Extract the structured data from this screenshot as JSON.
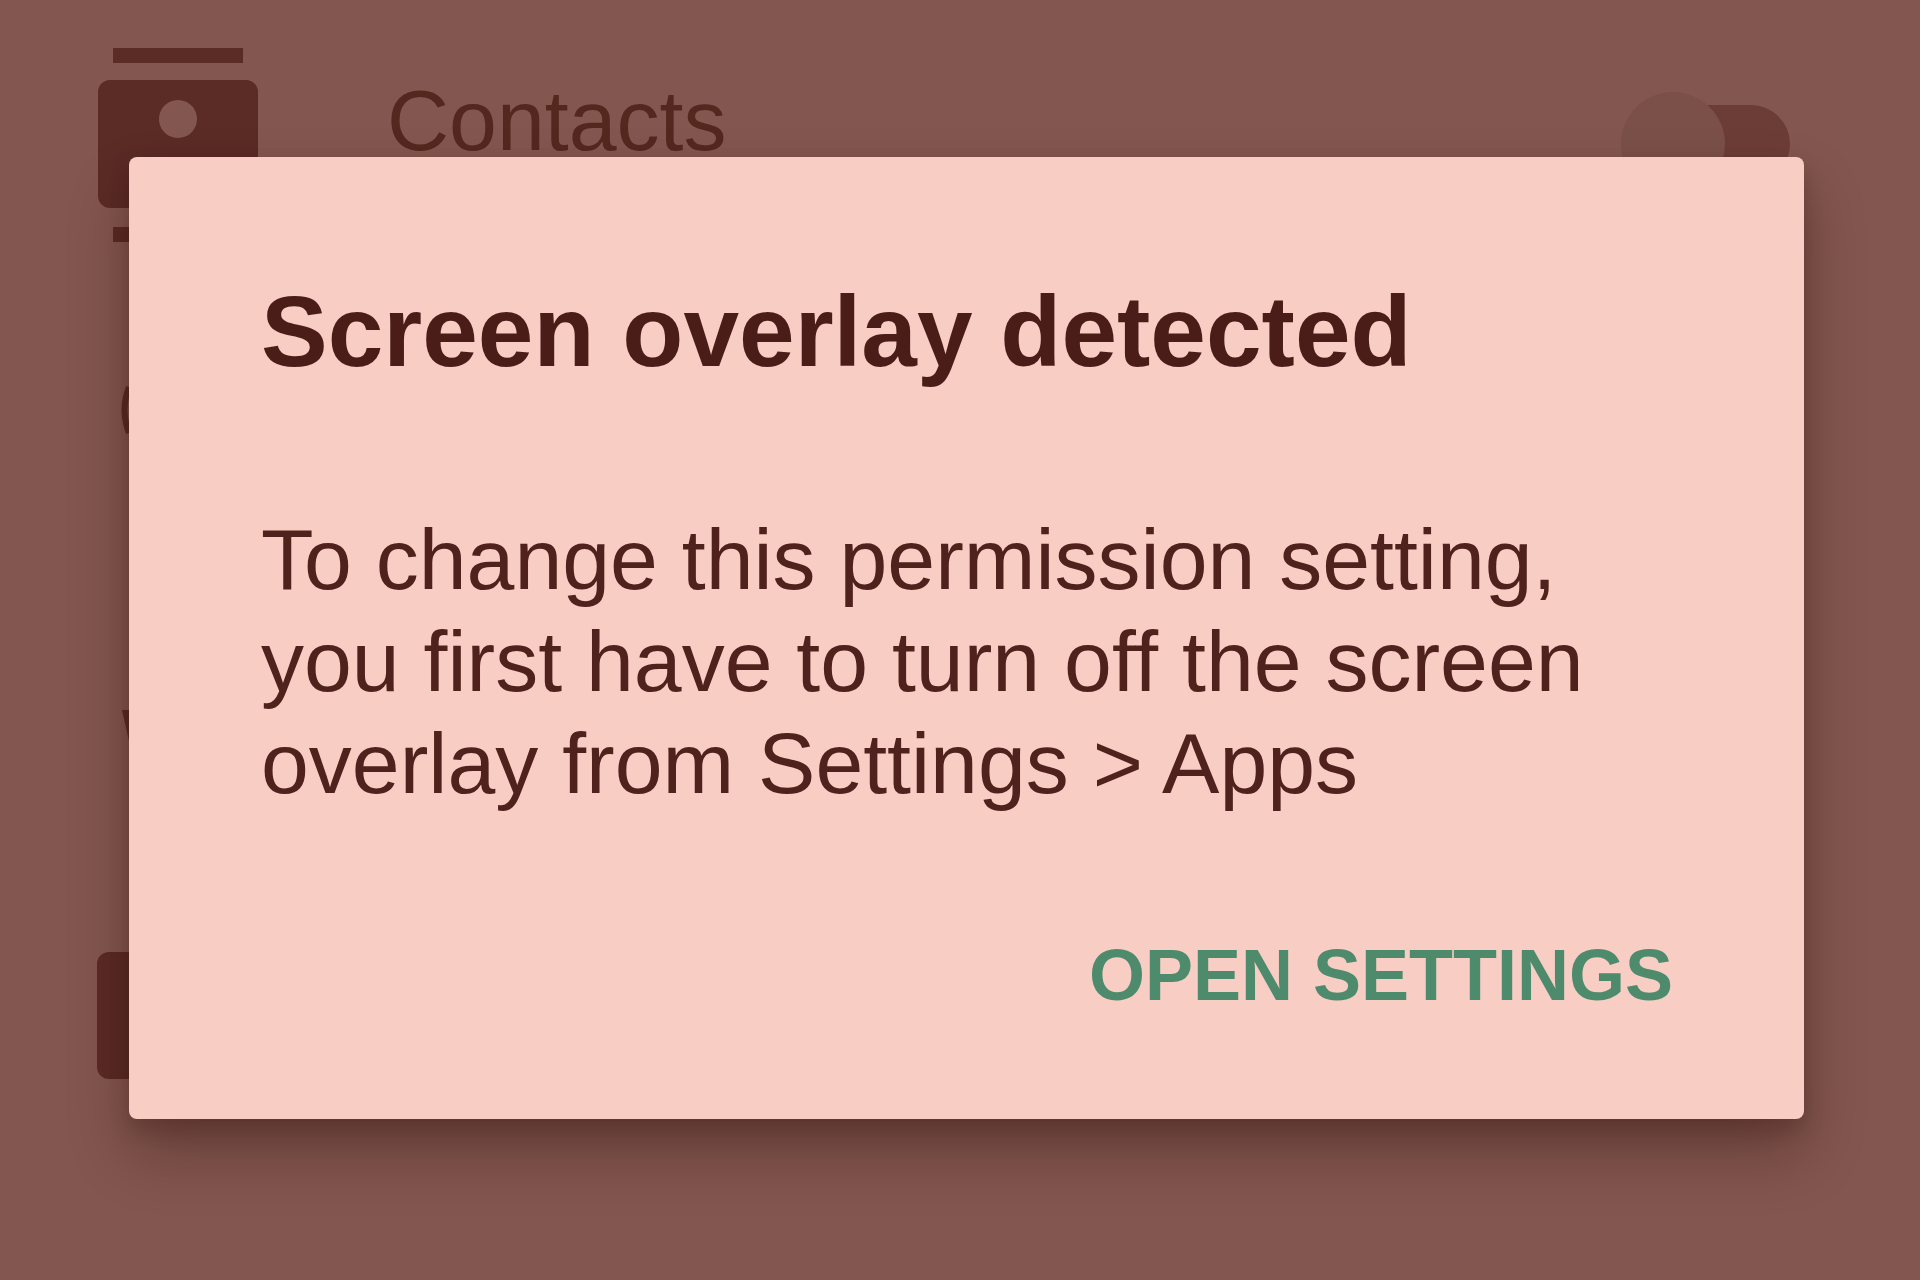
{
  "background": {
    "list_item": {
      "label": "Contacts",
      "switch": {
        "on": false
      }
    }
  },
  "dialog": {
    "title": "Screen overlay detected",
    "message": "To change this permission setting, you first have to turn off the screen overlay from Settings > Apps",
    "buttons": [
      {
        "label": "OPEN SETTINGS"
      }
    ]
  }
}
